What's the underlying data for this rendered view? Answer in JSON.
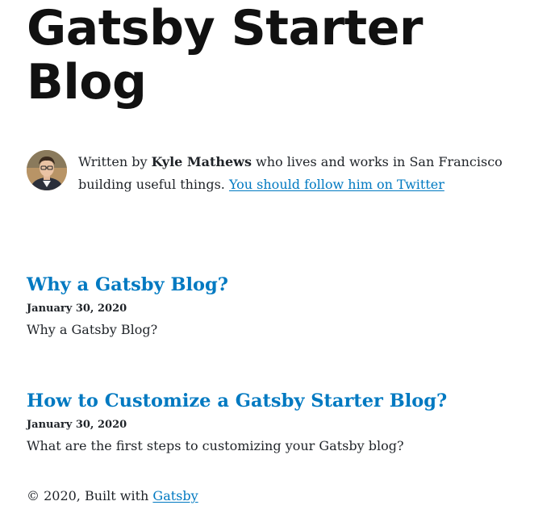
{
  "site": {
    "title": "Gatsby Starter Blog"
  },
  "bio": {
    "prefix": "Written by ",
    "author": "Kyle Mathews",
    "suffix": " who lives and works in San Francisco building useful things. ",
    "twitter_link": "You should follow him on Twitter"
  },
  "posts": [
    {
      "title": "Why a Gatsby Blog?",
      "date": "January 30, 2020",
      "excerpt": "Why a Gatsby Blog?"
    },
    {
      "title": "How to Customize a Gatsby Starter Blog?",
      "date": "January 30, 2020",
      "excerpt": "What are the first steps to customizing your Gatsby blog?"
    }
  ],
  "footer": {
    "text": "© 2020, Built with ",
    "link": "Gatsby"
  },
  "colors": {
    "link": "#0079c1",
    "text": "#1f2328"
  },
  "icons": {
    "avatar": "author-avatar-photo"
  }
}
